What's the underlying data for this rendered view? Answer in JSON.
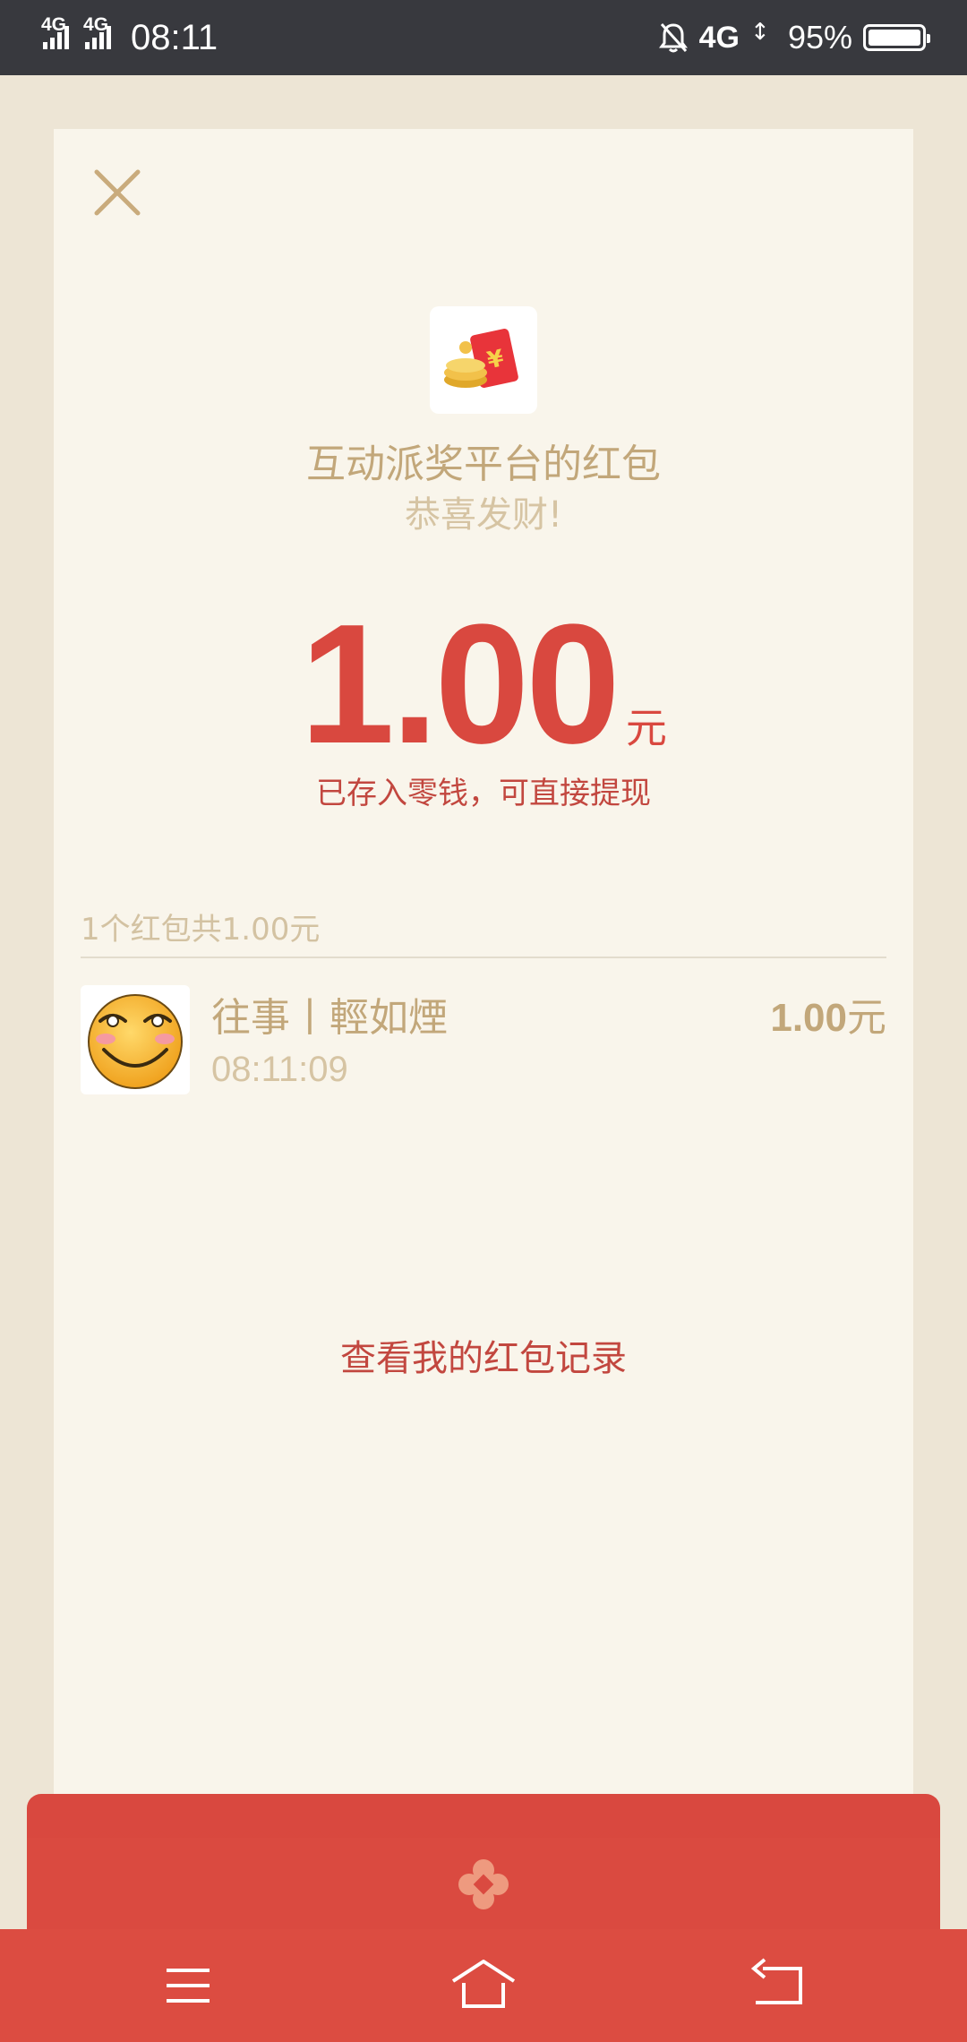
{
  "status_bar": {
    "sim1_network": "4G",
    "sim2_network": "4G",
    "time": "08:11",
    "mobile_data": "4G",
    "battery_percent": "95%",
    "icons": [
      "signal-icon",
      "signal-icon",
      "mute-bell-icon",
      "battery-icon"
    ]
  },
  "card": {
    "sender_title": "互动派奖平台的红包",
    "greeting": "恭喜发财!",
    "amount": "1.00",
    "amount_unit": "元",
    "stored_note": "已存入零钱，可直接提现",
    "summary": "1个红包共1.00元",
    "records": [
      {
        "name": "往事丨輕如煙",
        "time": "08:11:09",
        "amount": "1.00",
        "unit": "元",
        "avatar": "smiley-face-avatar"
      }
    ],
    "history_link": "查看我的红包记录"
  },
  "nav_bar": {
    "icons": [
      "menu-icon",
      "home-icon",
      "back-icon"
    ]
  },
  "colors": {
    "status_bar_bg": "#38393e",
    "page_bg": "#ede5d5",
    "card_bg": "#f9f5eb",
    "accent_red": "#d9483f",
    "gold_text": "#c2a77a",
    "muted_text": "#d6c4a3"
  }
}
